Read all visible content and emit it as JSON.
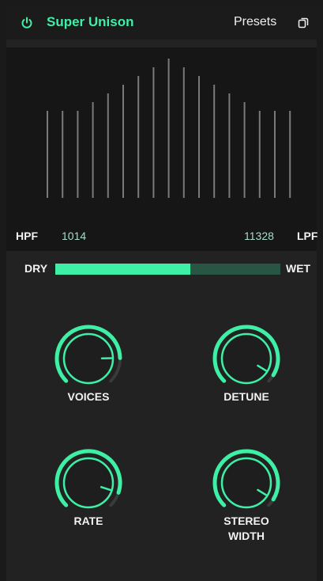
{
  "header": {
    "title": "Super Unison",
    "presets_label": "Presets",
    "power_icon": "power-icon",
    "copy_icon": "copy-icon"
  },
  "filter": {
    "hpf_label": "HPF",
    "hpf_value": "1014",
    "lpf_value": "11328",
    "lpf_label": "LPF",
    "bar_levels": [
      0.5,
      0.5,
      0.5,
      0.55,
      0.6,
      0.65,
      0.7,
      0.75,
      0.8,
      0.75,
      0.7,
      0.65,
      0.6,
      0.55,
      0.5,
      0.5,
      0.5
    ],
    "bar_color": "#7a7a7a"
  },
  "mix": {
    "dry_label": "DRY",
    "wet_label": "WET",
    "value": 0.6
  },
  "knobs": [
    {
      "label": "VOICES",
      "value": 0.83
    },
    {
      "label": "DETUNE",
      "value": 0.95
    },
    {
      "label": "RATE",
      "value": 0.9
    },
    {
      "label": "STEREO\nWIDTH",
      "value": 0.95
    }
  ],
  "colors": {
    "accent": "#3ef0a6",
    "track_off": "#3a3a3a",
    "background": "#222222"
  }
}
